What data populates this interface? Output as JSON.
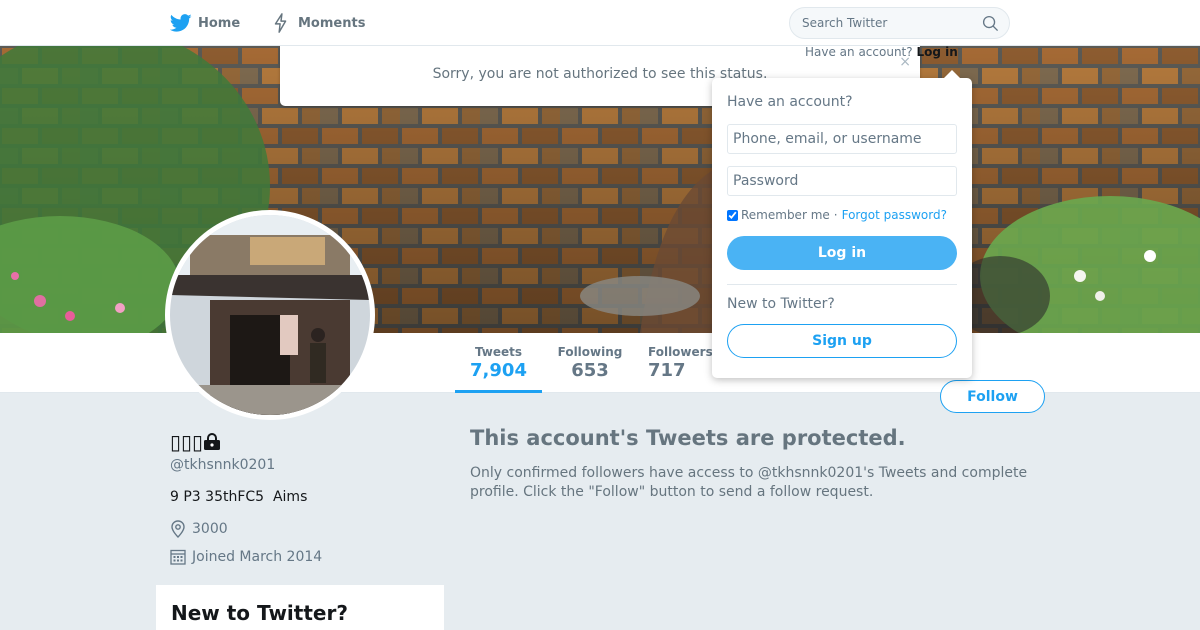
{
  "nav": {
    "home_label": "Home",
    "moments_label": "Moments",
    "search_placeholder": "Search Twitter",
    "have_account_text": "Have an account?",
    "login_link": "Log in"
  },
  "alert": {
    "message": "Sorry, you are not authorized to see this status.",
    "close_glyph": "×"
  },
  "stats": {
    "tweets_label": "Tweets",
    "tweets_value": "7,904",
    "following_label": "Following",
    "following_value": "653",
    "followers_label": "Followers",
    "followers_value": "717"
  },
  "follow_button": "Follow",
  "profile": {
    "name": "▯▯▯",
    "handle": "@tkhsnnk0201",
    "bio": "9 P3 35thFC5  Aims",
    "location": "3000",
    "joined": "Joined March 2014"
  },
  "protected": {
    "title": "This account's Tweets are protected.",
    "text": "Only confirmed followers have access to @tkhsnnk0201's Tweets and complete profile. Click the \"Follow\" button to send a follow request."
  },
  "new_card": {
    "title": "New to Twitter?"
  },
  "login_dropdown": {
    "title": "Have an account?",
    "username_placeholder": "Phone, email, or username",
    "password_placeholder": "Password",
    "remember_label": "Remember me",
    "separator": "·",
    "forgot_label": "Forgot password?",
    "login_button": "Log in",
    "new_label": "New to Twitter?",
    "signup_button": "Sign up"
  },
  "colors": {
    "accent": "#1da1f2",
    "background": "#e6ecf0",
    "muted_text": "#657786"
  }
}
